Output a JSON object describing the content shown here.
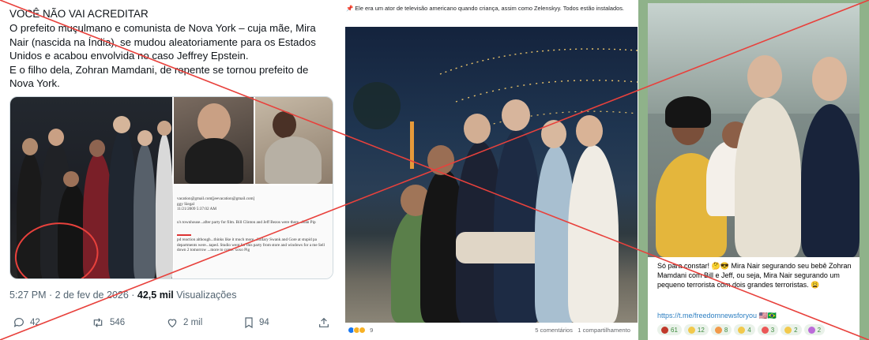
{
  "tweet": {
    "headline": "VOCÊ NÃO VAI ACREDITAR",
    "body": "O prefeito muçulmano e comunista de Nova York – cuja mãe, Mira Nair (nascida na Índia), se mudou aleatoriamente para os Estados Unidos e acabou envolvida no caso Jeffrey Epstein.\nE o filho dela, Zohran Mamdani, de repente se tornou prefeito de Nova York.",
    "document_lines": {
      "line1": "vacation@gmail.com[jeevacation@gmail.com]",
      "line2": "ggy Siegal",
      "line3": "11/21/2009 5:37:02 AM",
      "line4": "u's townhouse...after party for film.  Bill Clinton and Jeff Bezos were there...Joan Pip",
      "line5": "pd reaction although...thinks like it much more...Hillary Swank and Gore at stupid pa departments were...taped. Studio went for this party from store and windows for a me Sell down 2 tomorrow ...more to come. xoxo Pig"
    },
    "time": "5:27 PM · 2 de fev de 2026 · ",
    "views_count": "42,5 mil",
    "views_label": " Visualizações",
    "actions": {
      "replies": "42",
      "retweets": "546",
      "likes": "2 mil",
      "bookmarks": "94"
    }
  },
  "facebook": {
    "caption": "📌 Ele era um ator de televisão americano quando criança, assim como Zelenskyy. Todos estão instalados.",
    "reaction_count": "9",
    "comments": "5 comentários",
    "shares": "1 compartilhamento"
  },
  "telegram": {
    "message": "Só para constar! 🤔😎 Mira Nair segurando seu bebê Zohran Mamdani com Bill e Jeff, ou seja, Mira Nair segurando um pequeno terrorista com dois grandes terroristas. 😩",
    "link": "https://t.me/freedomnewsforyou 🇺🇸🇧🇷",
    "reactions": [
      {
        "count": "61",
        "color": "#c0392b"
      },
      {
        "count": "12",
        "color": "#f2c94c"
      },
      {
        "count": "8",
        "color": "#f2994a"
      },
      {
        "count": "4",
        "color": "#f2c94c"
      },
      {
        "count": "3",
        "color": "#eb5757"
      },
      {
        "count": "2",
        "color": "#f2c94c"
      },
      {
        "count": "2",
        "color": "#bb6bd9"
      }
    ]
  },
  "colors": {
    "cross": "#e8413c",
    "tweet_link_gray": "#536471",
    "telegram_bg": "#8fb28a",
    "telegram_link": "#2f80c2"
  }
}
